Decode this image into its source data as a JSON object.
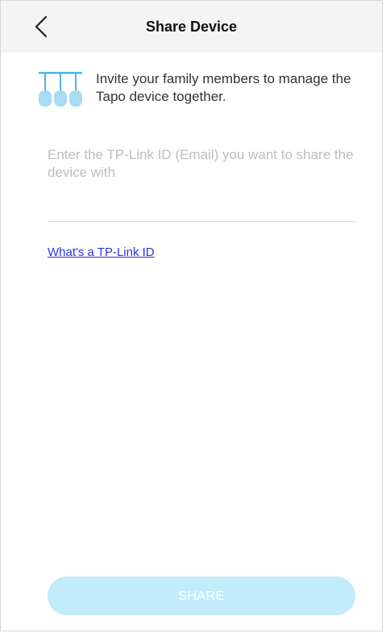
{
  "header": {
    "back_icon": "chevron-left-icon",
    "title": "Share Device"
  },
  "intro": {
    "icon": "share-people-icon",
    "text": "Invite your family members to manage the Tapo device together."
  },
  "email_field": {
    "value": "",
    "placeholder": "Enter the TP-Link ID (Email) you want to share the device with"
  },
  "help_link": {
    "label": "What's a TP-Link ID"
  },
  "share_button": {
    "label": "SHARE",
    "state": "disabled"
  },
  "colors": {
    "header_bg": "#f4f4f4",
    "accent": "#4ab6e8",
    "button_disabled_bg": "#c2ecfa",
    "link": "#2a35d9"
  }
}
